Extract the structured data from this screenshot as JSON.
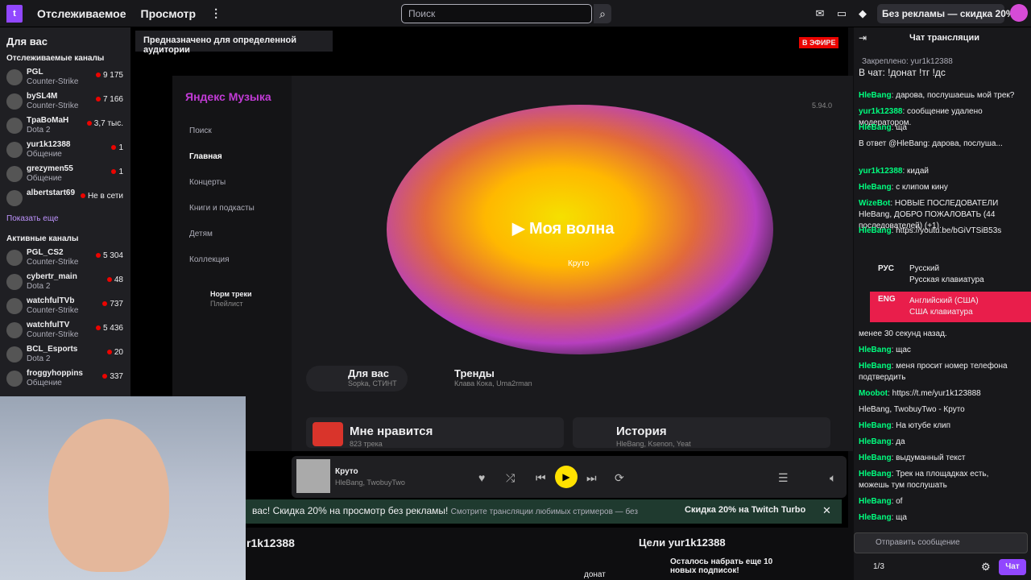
{
  "topbar": {
    "following": "Отслеживаемое",
    "browse": "Просмотр",
    "more": "⋮",
    "search_placeholder": "Поиск",
    "turbo": "Без рекламы — скидка 20%"
  },
  "sidebar": {
    "title": "Для вас",
    "followed_header": "Отслеживаемые каналы",
    "channels": [
      {
        "name": "PGL",
        "game": "Counter-Strike",
        "viewers": "9 175"
      },
      {
        "name": "bySL4M",
        "game": "Counter-Strike",
        "viewers": "7 166"
      },
      {
        "name": "TpaBoMaH",
        "game": "Dota 2",
        "viewers": "3,7 тыс."
      },
      {
        "name": "yur1k12388",
        "game": "Общение",
        "viewers": "1"
      },
      {
        "name": "grezymen55",
        "game": "Общение",
        "viewers": "1"
      },
      {
        "name": "albertstart69",
        "game": "",
        "viewers": "Не в сети"
      }
    ],
    "show_more": "Показать еще",
    "active_header": "Активные каналы",
    "active": [
      {
        "name": "PGL_CS2",
        "game": "Counter-Strike",
        "viewers": "5 304"
      },
      {
        "name": "cybertr_main",
        "game": "Dota 2",
        "viewers": "48"
      },
      {
        "name": "watchfulTVb",
        "game": "Counter-Strike",
        "viewers": "737"
      },
      {
        "name": "watchfulTV",
        "game": "Counter-Strike",
        "viewers": "5 436"
      },
      {
        "name": "BCL_Esports",
        "game": "Dota 2",
        "viewers": "20"
      },
      {
        "name": "froggyhoppins",
        "game": "Общение",
        "viewers": "337"
      }
    ]
  },
  "stream": {
    "audience": "Предназначено для определенной аудитории",
    "live": "В ЭФИРЕ"
  },
  "ym": {
    "logo": "Яндекс Музыка",
    "version": "5.94.0",
    "nav": [
      "Поиск",
      "Главная",
      "Концерты",
      "Книги и подкасты",
      "Детям",
      "Коллекция"
    ],
    "playlist_title": "Норм треки",
    "playlist_sub": "Плейлист",
    "wave": "▶ Моя волна",
    "chip_label": "Круто",
    "for_you": "Для вас",
    "for_you_sub": "Sopka, СТИНТ",
    "trends": "Тренды",
    "trends_sub": "Клава Кока, Uma2rman",
    "liked": "Мне нравится",
    "liked_sub": "823 трека",
    "history": "История",
    "history_sub": "HleBang, Ksenon, Yeat",
    "track": "Круто",
    "artist": "HleBang, TwobuyTwo"
  },
  "banner": {
    "text": "вас! Скидка 20% на просмотр без рекламы!",
    "sub": "Смотрите трансляции любимых стримеров — без",
    "cta": "Скидка 20% на Twitch Turbo"
  },
  "bottom": {
    "streamer": "r1k12388",
    "goals": "Цели yur1k12388",
    "goal_text": "Осталось набрать еще 10 новых подписок!",
    "donate": "донат"
  },
  "chat": {
    "title": "Чат трансляции",
    "pinned": "Закреплено: yur1k12388",
    "pinned_msg": "В чат: !донат !тг !дс",
    "lines": [
      {
        "u": "HleBang",
        "m": ": дарова, послушаешь мой трек?"
      },
      {
        "u": "yur1k12388",
        "m": ": сообщение удалено модератором."
      },
      {
        "u": "HleBang",
        "m": ": ща"
      },
      {
        "u": "",
        "m": "В ответ @HleBang: дарова, послуша..."
      },
      {
        "u": "yur1k12388",
        "m": ": кидай"
      },
      {
        "u": "HleBang",
        "m": ": с клипом кину"
      },
      {
        "u": "WizeBot",
        "m": ": НОВЫЕ ПОСЛЕДОВАТЕЛИ HleBang, ДОБРО ПОЖАЛОВАТЬ (44 последователей) (+1)."
      },
      {
        "u": "HleBang",
        "m": ": https://youtu.be/bGiVTSiB53s"
      }
    ],
    "lang": [
      {
        "code": "РУС",
        "name": "Русский",
        "kb": "Русская клавиатура"
      },
      {
        "code": "ENG",
        "name": "Английский (США)",
        "kb": "США клавиатура"
      }
    ],
    "lines2": [
      {
        "u": "",
        "m": "менее 30 секунд назад."
      },
      {
        "u": "HleBang",
        "m": ": щас"
      },
      {
        "u": "HleBang",
        "m": ": меня просит номер телефона подтвердить"
      },
      {
        "u": "Moobot",
        "m": ": https://t.me/yur1k123888"
      },
      {
        "u": "",
        "m": "HleBang, TwobuyTwo - Круто"
      },
      {
        "u": "HleBang",
        "m": ": На ютубе клип"
      },
      {
        "u": "HleBang",
        "m": ": да"
      },
      {
        "u": "HleBang",
        "m": ": выдуманный текст"
      },
      {
        "u": "HleBang",
        "m": ": Трек на площадках есть, можешь тум послушать"
      },
      {
        "u": "HleBang",
        "m": ": of"
      },
      {
        "u": "HleBang",
        "m": ": ща"
      }
    ],
    "input_placeholder": "Отправить сообщение",
    "points": "1/3",
    "send": "Чат"
  }
}
